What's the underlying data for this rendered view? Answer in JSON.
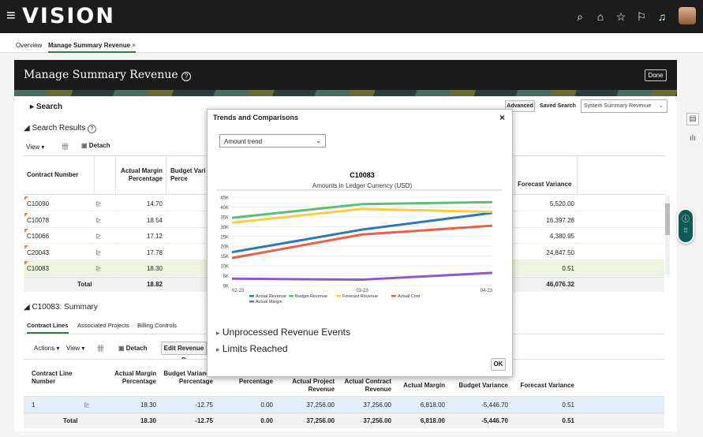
{
  "app": {
    "logo": "VISION",
    "menu_icon": "hamburger-icon",
    "icons": [
      "search-icon",
      "home-icon",
      "star-icon",
      "flag-icon",
      "bell-icon"
    ]
  },
  "tabs": [
    {
      "label": "Overview"
    },
    {
      "label": "Manage Summary Revenue",
      "close": "×"
    }
  ],
  "page": {
    "title": "Manage Summary Revenue",
    "help": "?",
    "done_label": "Done"
  },
  "search": {
    "label": "Search",
    "advanced": "Advanced",
    "saved_search_label": "Saved Search",
    "saved_search_value": "System Summary Revenue"
  },
  "results": {
    "title": "Search Results",
    "view_label": "View",
    "detach_label": "Detach",
    "headers": {
      "contract": "Contract Number",
      "actual_margin": "Actual Margin Percentage",
      "budget_var": "Budget Vari Perce",
      "forecast_var": "Forecast Variance"
    },
    "rows": [
      {
        "contract": "C10090",
        "margin": "14.70",
        "forecast": "5,520.00"
      },
      {
        "contract": "C10078",
        "margin": "18.54",
        "forecast": "16,397.28"
      },
      {
        "contract": "C10066",
        "margin": "17.12",
        "forecast": "4,380.95"
      },
      {
        "contract": "C20043",
        "margin": "17.78",
        "forecast": "24,847.50"
      },
      {
        "contract": "C10083",
        "margin": "18.30",
        "forecast": "0.51"
      }
    ],
    "total": {
      "label": "Total",
      "margin": "18.82",
      "forecast": "46,076.32"
    }
  },
  "summary": {
    "title": "C10083: Summary",
    "tabs": [
      "Contract Lines",
      "Associated Projects",
      "Billing Controls"
    ],
    "actions_label": "Actions",
    "view_label": "View",
    "detach_label": "Detach",
    "edit_label": "Edit Revenue D",
    "headers": [
      "Contract Line Number",
      "Actual Margin Percentage",
      "Budget Variance Percentage",
      "Percentage",
      "Actual Project Revenue",
      "Actual Contract Revenue",
      "Actual Margin",
      "Budget Variance",
      "Forecast Variance"
    ],
    "row": [
      "1",
      "18.30",
      "-12.75",
      "0.00",
      "37,256.00",
      "37,256.00",
      "6,818.00",
      "-5,446.70",
      "0.51"
    ],
    "total": [
      "Total",
      "18.30",
      "-12.75",
      "0.00",
      "37,256.00",
      "37,256.00",
      "6,818.00",
      "-5,446.70",
      "0.51"
    ]
  },
  "modal": {
    "title": "Trends and Comparisons",
    "close": "×",
    "select_value": "Amount trend",
    "sections": [
      "Unprocessed Revenue Events",
      "Limits Reached"
    ],
    "ok_label": "OK"
  },
  "chart_data": {
    "type": "line",
    "title": "C10083",
    "subtitle": "Amounts in Ledger Currency (USD)",
    "categories": [
      "02-23",
      "03-23",
      "04-23"
    ],
    "y_ticks": [
      "0K",
      "5K",
      "10K",
      "15K",
      "20K",
      "25K",
      "30K",
      "35K",
      "40K",
      "45K"
    ],
    "ylim": [
      0,
      45000
    ],
    "series": [
      {
        "name": "Actual Revenue",
        "color": "#2e78b8",
        "values": [
          17000,
          28500,
          37000
        ]
      },
      {
        "name": "Budget Revenue",
        "color": "#5cbf73",
        "values": [
          34500,
          41500,
          42500
        ]
      },
      {
        "name": "Forecast Revenue",
        "color": "#f5cf45",
        "values": [
          32000,
          39000,
          37500
        ]
      },
      {
        "name": "Actual Cost",
        "color": "#e8604a",
        "values": [
          14000,
          26000,
          30500
        ]
      },
      {
        "name": "Actual Margin",
        "color": "#8a5cc8",
        "values": [
          3500,
          3000,
          6500
        ]
      }
    ]
  }
}
